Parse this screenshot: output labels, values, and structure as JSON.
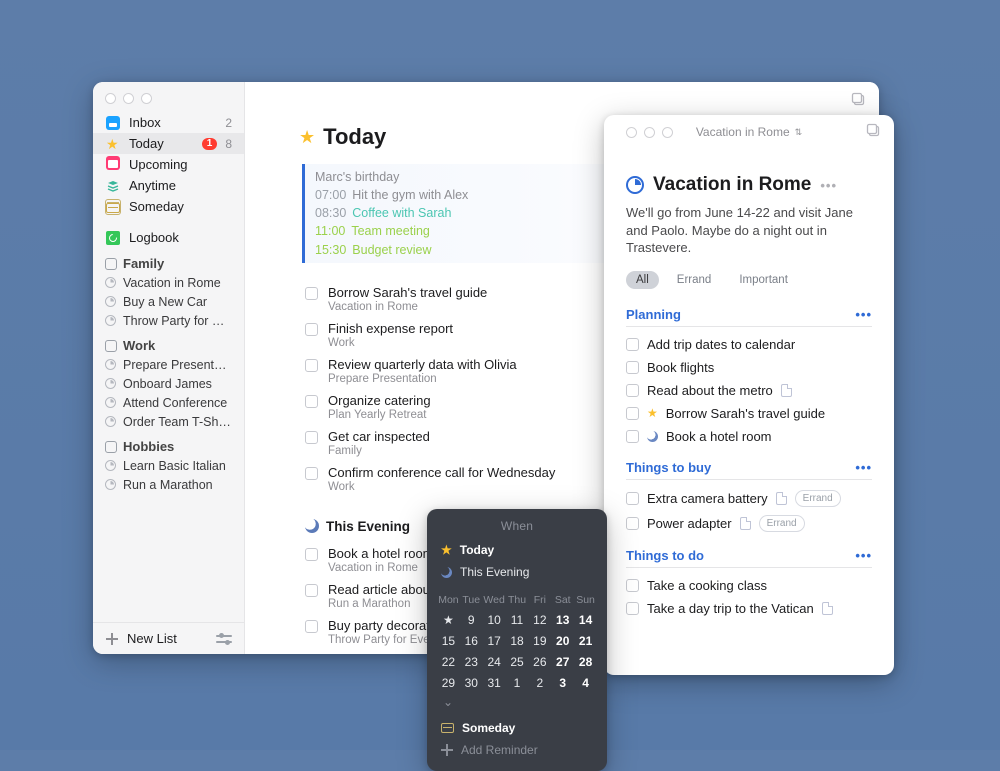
{
  "sidebar": {
    "inbox": {
      "label": "Inbox",
      "count": "2"
    },
    "today": {
      "label": "Today",
      "badge": "1",
      "count": "8"
    },
    "upcoming": {
      "label": "Upcoming"
    },
    "anytime": {
      "label": "Anytime"
    },
    "someday": {
      "label": "Someday"
    },
    "logbook": {
      "label": "Logbook"
    },
    "areas": [
      {
        "name": "Family",
        "projects": [
          "Vacation in Rome",
          "Buy a New Car",
          "Throw Party for Eve"
        ]
      },
      {
        "name": "Work",
        "projects": [
          "Prepare Presentation",
          "Onboard James",
          "Attend Conference",
          "Order Team T-Shirts"
        ]
      },
      {
        "name": "Hobbies",
        "projects": [
          "Learn Basic Italian",
          "Run a Marathon"
        ]
      }
    ],
    "new_list": "New List"
  },
  "today": {
    "title": "Today",
    "schedule": [
      {
        "time": "",
        "text": "Marc's birthday",
        "cls": "birthday"
      },
      {
        "time": "07:00",
        "text": "Hit the gym with Alex",
        "cls": ""
      },
      {
        "time": "08:30",
        "text": "Coffee with Sarah",
        "cls": "teal"
      },
      {
        "time": "11:00",
        "text": "Team meeting",
        "cls": "green"
      },
      {
        "time": "15:30",
        "text": "Budget review",
        "cls": "green"
      }
    ],
    "tasks": [
      {
        "title": "Borrow Sarah's travel guide",
        "sub": "Vacation in Rome"
      },
      {
        "title": "Finish expense report",
        "sub": "Work"
      },
      {
        "title": "Review quarterly data with Olivia",
        "sub": "Prepare Presentation"
      },
      {
        "title": "Organize catering",
        "sub": "Plan Yearly Retreat"
      },
      {
        "title": "Get car inspected",
        "sub": "Family"
      },
      {
        "title": "Confirm conference call for Wednesday",
        "sub": "Work"
      }
    ],
    "evening_title": "This Evening",
    "evening": [
      {
        "title": "Book a hotel room",
        "sub": "Vacation in Rome"
      },
      {
        "title": "Read article about",
        "sub": "Run a Marathon"
      },
      {
        "title": "Buy party decoratio",
        "sub": "Throw Party for Eve"
      }
    ]
  },
  "project": {
    "titlebar": "Vacation in Rome",
    "title": "Vacation in Rome",
    "desc": "We'll go from June 14-22 and visit Jane and Paolo. Maybe do a night out in Trastevere.",
    "tags": [
      "All",
      "Errand",
      "Important"
    ],
    "groups": [
      {
        "name": "Planning",
        "items": [
          {
            "text": "Add trip dates to calendar",
            "file": false
          },
          {
            "text": "Book flights",
            "file": false
          },
          {
            "text": "Read about the metro",
            "file": true
          },
          {
            "text": "Borrow Sarah's travel guide",
            "star": true
          },
          {
            "text": "Book a hotel room",
            "moon": true
          }
        ]
      },
      {
        "name": "Things to buy",
        "items": [
          {
            "text": "Extra camera battery",
            "file": true,
            "chip": "Errand"
          },
          {
            "text": "Power adapter",
            "file": true,
            "chip": "Errand"
          }
        ]
      },
      {
        "name": "Things to do",
        "items": [
          {
            "text": "Take a cooking class",
            "file": false
          },
          {
            "text": "Take a day trip to the Vatican",
            "file": true
          }
        ]
      }
    ]
  },
  "when": {
    "title": "When",
    "today": "Today",
    "evening": "This Evening",
    "days": [
      "Mon",
      "Tue",
      "Wed",
      "Thu",
      "Fri",
      "Sat",
      "Sun"
    ],
    "weeks": [
      [
        "★",
        "9",
        "10",
        "11",
        "12",
        "13",
        "14"
      ],
      [
        "15",
        "16",
        "17",
        "18",
        "19",
        "20",
        "21"
      ],
      [
        "22",
        "23",
        "24",
        "25",
        "26",
        "27",
        "28"
      ],
      [
        "29",
        "30",
        "31",
        "1",
        "2",
        "3",
        "4"
      ]
    ],
    "someday": "Someday",
    "add": "Add Reminder"
  }
}
